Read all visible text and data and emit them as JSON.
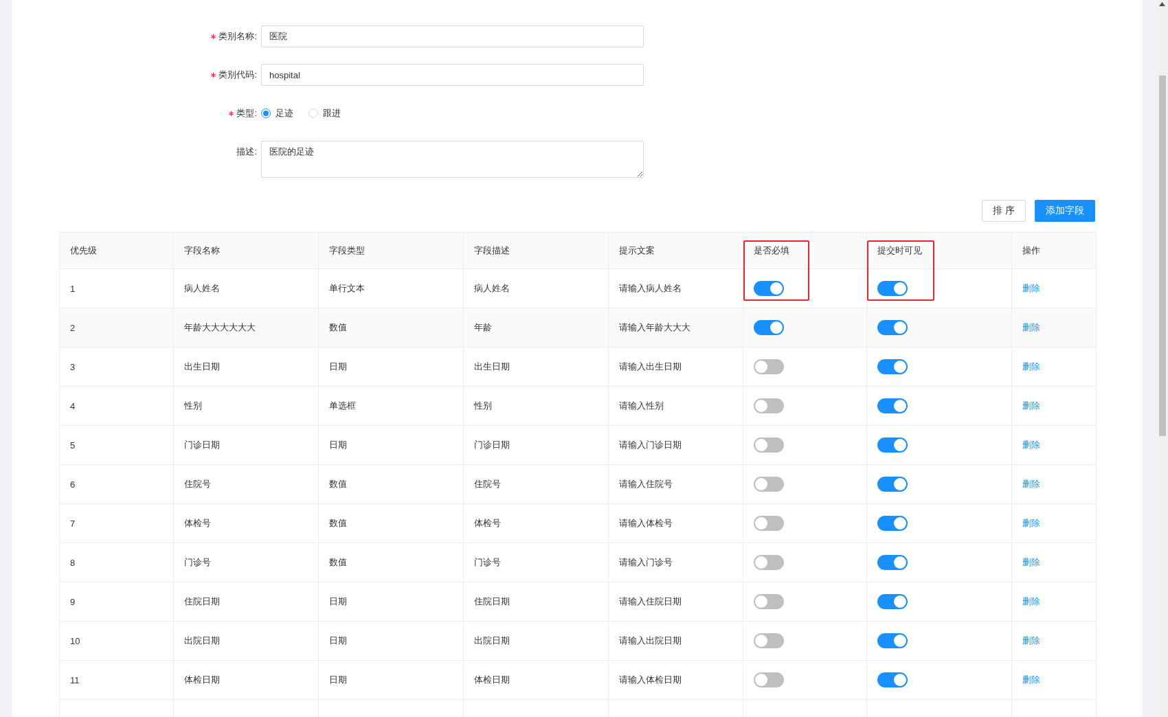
{
  "form": {
    "fields": [
      {
        "kind": "input",
        "label": "类别名称:",
        "required": true,
        "value": "医院"
      },
      {
        "kind": "input",
        "label": "类别代码:",
        "required": true,
        "value": "hospital"
      },
      {
        "kind": "radio",
        "label": "类型:",
        "required": true,
        "options": [
          {
            "label": "足迹",
            "selected": true
          },
          {
            "label": "跟进",
            "selected": false
          }
        ]
      },
      {
        "kind": "textarea",
        "label": "描述:",
        "required": false,
        "value": "医院的足迹"
      }
    ]
  },
  "toolbar": {
    "buttons": [
      {
        "label": "排 序",
        "primary": false
      },
      {
        "label": "添加字段",
        "primary": true
      }
    ]
  },
  "table": {
    "columns": [
      {
        "label": "优先级",
        "highlighted": false
      },
      {
        "label": "字段名称",
        "highlighted": false
      },
      {
        "label": "字段类型",
        "highlighted": false
      },
      {
        "label": "字段描述",
        "highlighted": false
      },
      {
        "label": "提示文案",
        "highlighted": false
      },
      {
        "label": "是否必填",
        "highlighted": true
      },
      {
        "label": "提交时可见",
        "highlighted": true
      },
      {
        "label": "操作",
        "highlighted": false
      }
    ],
    "rows": [
      {
        "priority": "1",
        "name": "病人姓名",
        "type": "单行文本",
        "description": "病人姓名",
        "hint": "请输入病人姓名",
        "required": true,
        "visible": true,
        "action": "删除",
        "hovered": false
      },
      {
        "priority": "2",
        "name": "年龄大大大大大大",
        "type": "数值",
        "description": "年龄",
        "hint": "请输入年龄大大大",
        "required": true,
        "visible": true,
        "action": "删除",
        "hovered": true
      },
      {
        "priority": "3",
        "name": "出生日期",
        "type": "日期",
        "description": "出生日期",
        "hint": "请输入出生日期",
        "required": false,
        "visible": true,
        "action": "删除",
        "hovered": false
      },
      {
        "priority": "4",
        "name": "性别",
        "type": "单选框",
        "description": "性别",
        "hint": "请输入性别",
        "required": false,
        "visible": true,
        "action": "删除",
        "hovered": false
      },
      {
        "priority": "5",
        "name": "门诊日期",
        "type": "日期",
        "description": "门诊日期",
        "hint": "请输入门诊日期",
        "required": false,
        "visible": true,
        "action": "删除",
        "hovered": false
      },
      {
        "priority": "6",
        "name": "住院号",
        "type": "数值",
        "description": "住院号",
        "hint": "请输入住院号",
        "required": false,
        "visible": true,
        "action": "删除",
        "hovered": false
      },
      {
        "priority": "7",
        "name": "体检号",
        "type": "数值",
        "description": "体检号",
        "hint": "请输入体检号",
        "required": false,
        "visible": true,
        "action": "删除",
        "hovered": false
      },
      {
        "priority": "8",
        "name": "门诊号",
        "type": "数值",
        "description": "门诊号",
        "hint": "请输入门诊号",
        "required": false,
        "visible": true,
        "action": "删除",
        "hovered": false
      },
      {
        "priority": "9",
        "name": "住院日期",
        "type": "日期",
        "description": "住院日期",
        "hint": "请输入住院日期",
        "required": false,
        "visible": true,
        "action": "删除",
        "hovered": false
      },
      {
        "priority": "10",
        "name": "出院日期",
        "type": "日期",
        "description": "出院日期",
        "hint": "请输入出院日期",
        "required": false,
        "visible": true,
        "action": "删除",
        "hovered": false
      },
      {
        "priority": "11",
        "name": "体检日期",
        "type": "日期",
        "description": "体检日期",
        "hint": "请输入体检日期",
        "required": false,
        "visible": true,
        "action": "删除",
        "hovered": false
      }
    ]
  }
}
